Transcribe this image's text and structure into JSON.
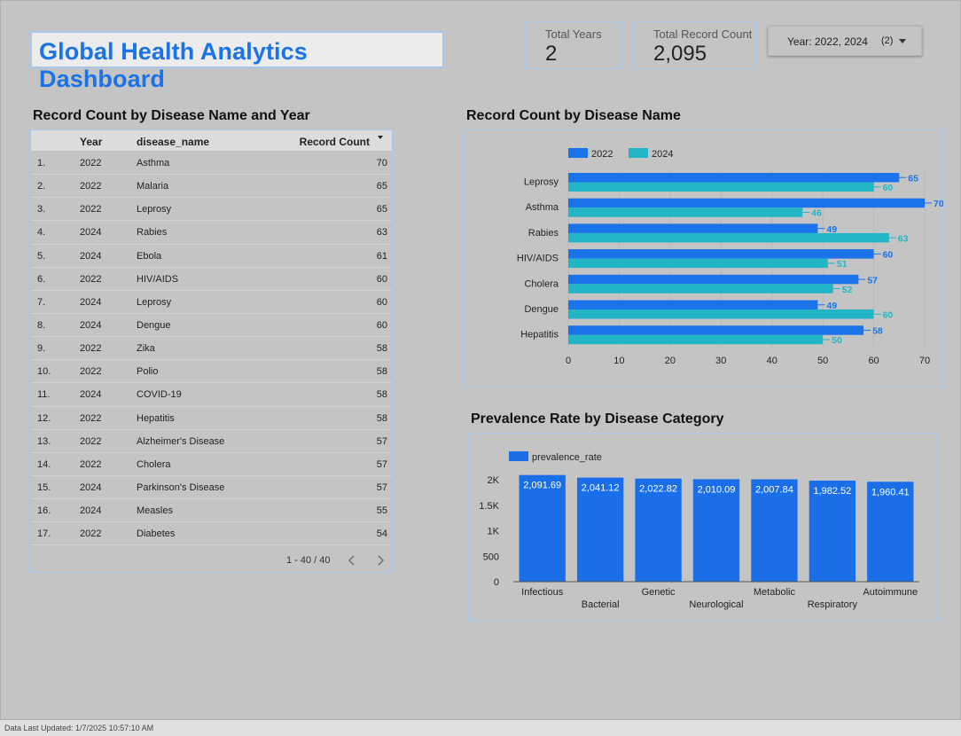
{
  "header": {
    "title": "Global Health Analytics Dashboard"
  },
  "scorecards": [
    {
      "label": "Total Years",
      "value": "2"
    },
    {
      "label": "Total Record Count",
      "value": "2,095"
    }
  ],
  "filter": {
    "label": "Year",
    "value": ": 2022, 2024",
    "count": "(2)"
  },
  "table": {
    "title": "Record Count by Disease Name and Year",
    "columns": [
      "Year",
      "disease_name",
      "Record Count"
    ],
    "rows": [
      [
        "1.",
        "2022",
        "Asthma",
        "70"
      ],
      [
        "2.",
        "2022",
        "Malaria",
        "65"
      ],
      [
        "3.",
        "2022",
        "Leprosy",
        "65"
      ],
      [
        "4.",
        "2024",
        "Rabies",
        "63"
      ],
      [
        "5.",
        "2024",
        "Ebola",
        "61"
      ],
      [
        "6.",
        "2022",
        "HIV/AIDS",
        "60"
      ],
      [
        "7.",
        "2024",
        "Leprosy",
        "60"
      ],
      [
        "8.",
        "2024",
        "Dengue",
        "60"
      ],
      [
        "9.",
        "2022",
        "Zika",
        "58"
      ],
      [
        "10.",
        "2022",
        "Polio",
        "58"
      ],
      [
        "11.",
        "2024",
        "COVID-19",
        "58"
      ],
      [
        "12.",
        "2022",
        "Hepatitis",
        "58"
      ],
      [
        "13.",
        "2022",
        "Alzheimer's Disease",
        "57"
      ],
      [
        "14.",
        "2022",
        "Cholera",
        "57"
      ],
      [
        "15.",
        "2024",
        "Parkinson's Disease",
        "57"
      ],
      [
        "16.",
        "2024",
        "Measles",
        "55"
      ],
      [
        "17.",
        "2022",
        "Diabetes",
        "54"
      ]
    ],
    "pagination": "1 - 40 / 40"
  },
  "chart_data": [
    {
      "type": "bar",
      "orientation": "horizontal",
      "title": "Record Count by Disease Name",
      "categories": [
        "Leprosy",
        "Asthma",
        "Rabies",
        "HIV/AIDS",
        "Cholera",
        "Dengue",
        "Hepatitis"
      ],
      "series": [
        {
          "name": "2022",
          "color": "#1a73e8",
          "label_color": "#1a73e8",
          "values": [
            65,
            70,
            49,
            60,
            57,
            49,
            58
          ]
        },
        {
          "name": "2024",
          "color": "#22b5c6",
          "label_color": "#22b5c6",
          "values": [
            60,
            46,
            63,
            51,
            52,
            60,
            50
          ]
        }
      ],
      "xlim": [
        0,
        70
      ],
      "xticks": [
        "0",
        "10",
        "20",
        "30",
        "40",
        "50",
        "60",
        "70"
      ],
      "legend": "top-left",
      "grid": true
    },
    {
      "type": "bar",
      "title": "Prevalence Rate by Disease Category",
      "categories": [
        "Infectious",
        "Bacterial",
        "Genetic",
        "Neurological",
        "Metabolic",
        "Respiratory",
        "Autoimmune"
      ],
      "series": [
        {
          "name": "prevalence_rate",
          "color": "#1a6fe8",
          "values": [
            2091.69,
            2041.12,
            2022.82,
            2010.09,
            2007.84,
            1982.52,
            1960.41
          ]
        }
      ],
      "data_labels": [
        "2,091.69",
        "2,041.12",
        "2,022.82",
        "2,010.09",
        "2,007.84",
        "1,982.52",
        "1,960.41"
      ],
      "ylim": [
        0,
        2000
      ],
      "yticks": [
        "0",
        "500",
        "1K",
        "1.5K",
        "2K"
      ],
      "legend": "top-left",
      "grid": false
    }
  ],
  "footer": {
    "text": "Data Last Updated: 1/7/2025 10:57:10 AM"
  }
}
